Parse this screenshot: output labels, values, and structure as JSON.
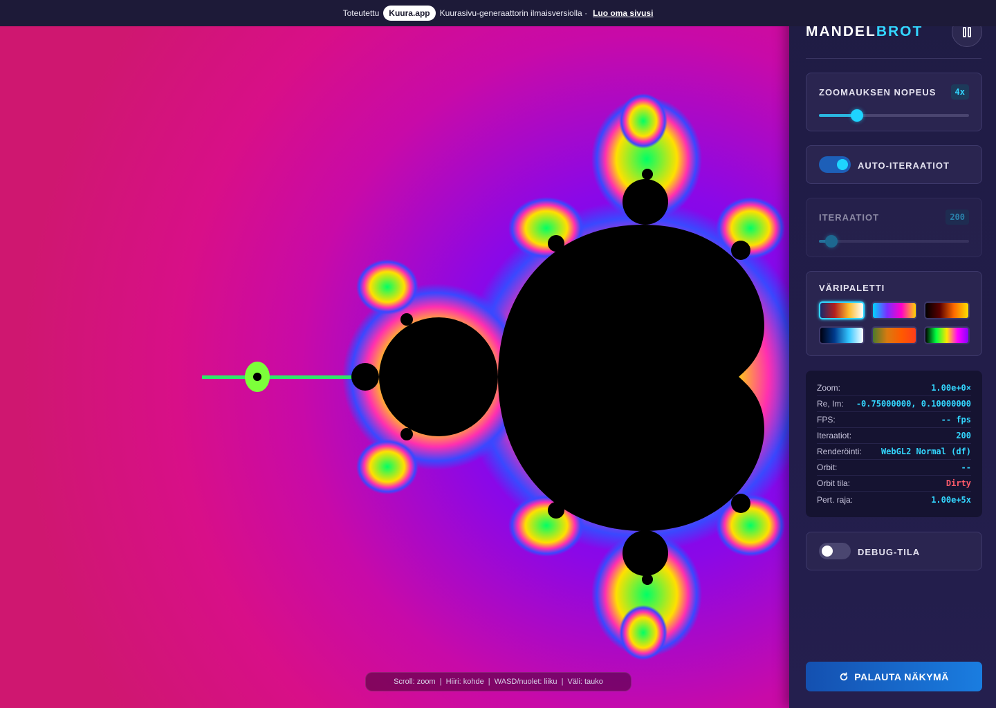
{
  "banner": {
    "prefix": "Toteutettu",
    "brand_pill": "Kuura.app",
    "suffix": "Kuurasivu-generaattorin ilmaisversiolla ·",
    "link": "Luo oma sivusi"
  },
  "sidebar": {
    "title_part1": "MANDEL",
    "title_part2": "BROT",
    "pause_icon": "pause-icon",
    "zoom_speed": {
      "label": "ZOOMAUKSEN NOPEUS",
      "value": "4x",
      "level": 0.23
    },
    "auto_iterations": {
      "label": "AUTO-ITERAATIOT",
      "enabled": true
    },
    "iterations": {
      "label": "ITERAATIOT",
      "value": "200",
      "level": 0.06,
      "disabled": true
    },
    "palette": {
      "label": "VÄRIPALETTI",
      "selected_index": 0,
      "swatches": [
        {
          "name": "palette-classic",
          "colors": [
            "#1a2a6c",
            "#b21f1f",
            "#fdbb2d",
            "#ffffff"
          ]
        },
        {
          "name": "palette-neon",
          "colors": [
            "#00d4ff",
            "#7a2cff",
            "#ff00c8",
            "#ffd400"
          ]
        },
        {
          "name": "palette-fire",
          "colors": [
            "#000000",
            "#5a0000",
            "#ff6a00",
            "#ffe100"
          ]
        },
        {
          "name": "palette-ocean",
          "colors": [
            "#000010",
            "#003a8c",
            "#33c6ff",
            "#ffffff"
          ]
        },
        {
          "name": "palette-autumn",
          "colors": [
            "#4b7a2c",
            "#d97a10",
            "#ff5a00",
            "#ff3d1a"
          ]
        },
        {
          "name": "palette-rainbow",
          "colors": [
            "#000000",
            "#00ff40",
            "#ffe600",
            "#ff00ff",
            "#8a00ff"
          ]
        }
      ]
    },
    "info": [
      {
        "key": "Zoom:",
        "value": "1.00e+0×",
        "status": "normal"
      },
      {
        "key": "Re, Im:",
        "value": "-0.75000000, 0.10000000",
        "status": "normal"
      },
      {
        "key": "FPS:",
        "value": "-- fps",
        "status": "normal"
      },
      {
        "key": "Iteraatiot:",
        "value": "200",
        "status": "normal"
      },
      {
        "key": "Renderöinti:",
        "value": "WebGL2 Normal (df)",
        "status": "normal"
      },
      {
        "key": "Orbit:",
        "value": "--",
        "status": "normal"
      },
      {
        "key": "Orbit tila:",
        "value": "Dirty",
        "status": "warn"
      },
      {
        "key": "Pert. raja:",
        "value": "1.00e+5x",
        "status": "normal"
      }
    ],
    "debug": {
      "label": "DEBUG-TILA",
      "enabled": false
    },
    "reset_button": "PALAUTA NÄKYMÄ",
    "reset_icon": "refresh-icon"
  },
  "hint": "Scroll: zoom  |  Hiiri: kohde  |  WASD/nuolet: liiku  |  Väli: tauko",
  "colors": {
    "accent": "#33d6ff",
    "warn": "#ff5b6b",
    "sidebar_bg": "#221d4a",
    "button_blue": "#1a6fd8"
  }
}
